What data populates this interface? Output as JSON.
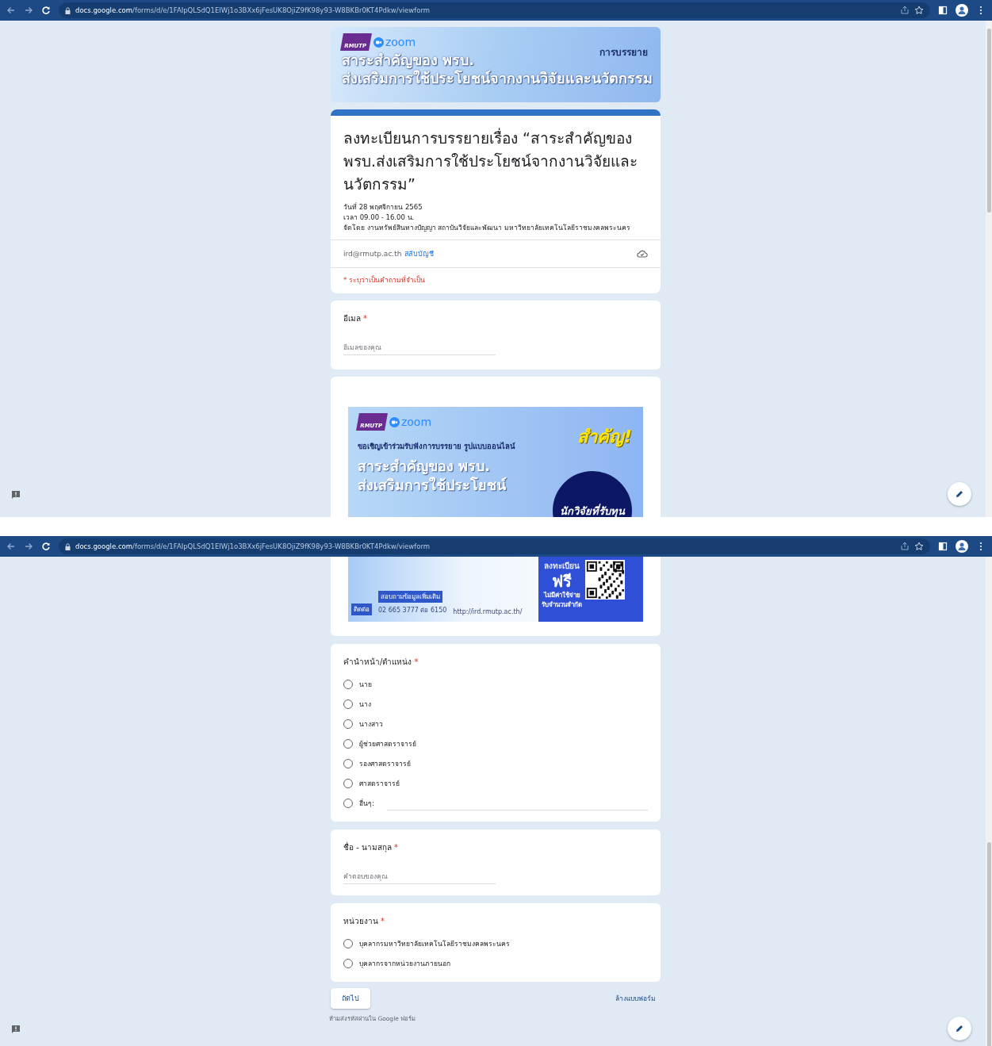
{
  "screens": [
    {
      "browser": {
        "host": "docs.google.com",
        "path": "/forms/d/e/1FAIpQLSdQ1EIWj1o3BXx6jFesUK8OjiZ9fK98y93-W8BKBr0KT4Pdkw/viewform"
      },
      "header_banner": {
        "logo": "RMUTP",
        "app": "zoom",
        "tag": "การบรรยาย",
        "lines": [
          "สาระสำคัญของ พรบ.",
          "ส่งเสริมการใช้ประโยชน์จากงานวิจัยและนวัตกรรม"
        ]
      },
      "title_card": {
        "title": "ลงทะเบียนการบรรยายเรื่อง “สาระสำคัญของ พรบ.ส่งเสริมการใช้ประโยชน์จากงานวิจัยและนวัตกรรม”",
        "details": [
          "วันที่ 28 พฤศจิกายน 2565",
          "เวลา 09.00 - 16.00 น.",
          "จัดโดย งานทรัพย์สินทางปัญญา สถาบันวิจัยและพัฒนา มหาวิทยาลัยเทคโนโลยีราชมงคลพระนคร"
        ],
        "account": {
          "email": "ird@rmutp.ac.th",
          "switch_link": "สลับบัญชี"
        },
        "required_note": "* ระบุว่าเป็นคำถามที่จำเป็น"
      },
      "questions": [
        {
          "kind": "short",
          "label": "อีเมล",
          "required_mark": "*",
          "placeholder": "อีเมลของคุณ"
        }
      ],
      "poster": {
        "logo": "RMUTP",
        "app": "zoom",
        "badge": "สำคัญ!",
        "invite": "ขอเชิญเข้าร่วมรับฟังการบรรยาย รูปแบบออนไลน์",
        "lines": [
          "สาระสำคัญของ พรบ.",
          "ส่งเสริมการใช้ประโยชน์"
        ],
        "circle": "นักวิจัยที่รับทุน"
      }
    },
    {
      "browser": {
        "host": "docs.google.com",
        "path": "/forms/d/e/1FAIpQLSdQ1EIWj1o3BXx6jFesUK8OjiZ9fK98y93-W8BKBr0KT4Pdkw/viewform"
      },
      "poster_bottom": {
        "contact_label": "ติดต่อ",
        "info_label": "สอบถามข้อมูลเพิ่มเติม",
        "phone": "02 665 3777 ต่อ 6150",
        "url": "http://ird.rmutp.ac.th/",
        "register": "ลงทะเบียน",
        "free": "ฟรี",
        "notes": [
          "ไม่มีค่าใช้จ่าย",
          "รับจำนวนจำกัด"
        ]
      },
      "questions": [
        {
          "kind": "radio",
          "label": "คำนำหน้า/ตำแหน่ง",
          "required_mark": "*",
          "options": [
            {
              "label": "นาย",
              "selected": false
            },
            {
              "label": "นาง",
              "selected": false
            },
            {
              "label": "นางสาว",
              "selected": false
            },
            {
              "label": "ผู้ช่วยศาสตราจารย์",
              "selected": false
            },
            {
              "label": "รองศาสตราจารย์",
              "selected": false
            },
            {
              "label": "ศาสตราจารย์",
              "selected": false
            },
            {
              "label": "อื่นๆ:",
              "selected": false,
              "other": true
            }
          ]
        },
        {
          "kind": "short",
          "label": "ชื่อ - นามสกุล",
          "required_mark": "*",
          "placeholder": "คำตอบของคุณ"
        },
        {
          "kind": "radio",
          "label": "หน่วยงาน",
          "required_mark": "*",
          "options": [
            {
              "label": "บุคลากรมหาวิทยาลัยเทคโนโลยีราชมงคลพระนคร",
              "selected": false
            },
            {
              "label": "บุคลากรจากหน่วยงานภายนอก",
              "selected": false
            }
          ]
        }
      ],
      "buttons": {
        "next": "ถัดไป",
        "clear": "ล้างแบบฟอร์ม"
      },
      "footer": "ห้ามส่งรหัสผ่านใน Google ฟอร์ม"
    }
  ]
}
